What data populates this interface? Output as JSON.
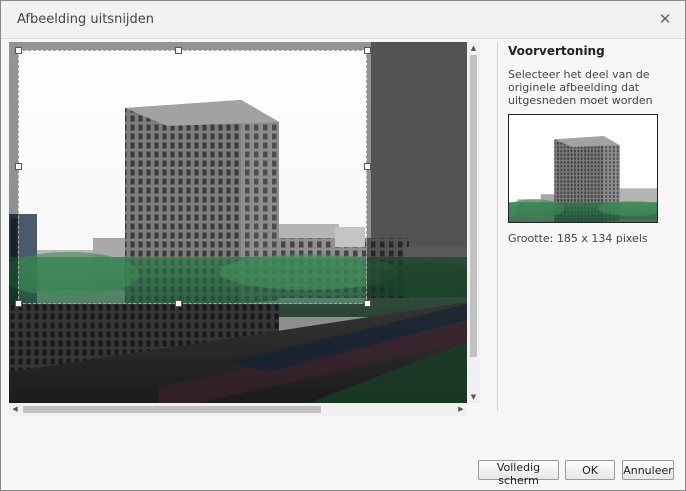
{
  "dialog": {
    "title": "Afbeelding uitsnijden",
    "close_icon": "close-icon"
  },
  "preview": {
    "heading": "Voorvertoning",
    "description": "Selecteer het deel van de originele afbeelding dat uitgesneden moet worden",
    "size_text": "Grootte: 185 x 134 pixels"
  },
  "buttons": {
    "fullscreen": "Volledig scherm",
    "ok": "OK",
    "cancel": "Annuleer"
  },
  "scrollbars": {
    "up_icon": "arrow-up-icon",
    "down_icon": "arrow-down-icon",
    "left_icon": "arrow-left-icon",
    "right_icon": "arrow-right-icon"
  },
  "colors": {
    "crop_outline": "#ffffff",
    "dim_overlay": "#000000"
  }
}
